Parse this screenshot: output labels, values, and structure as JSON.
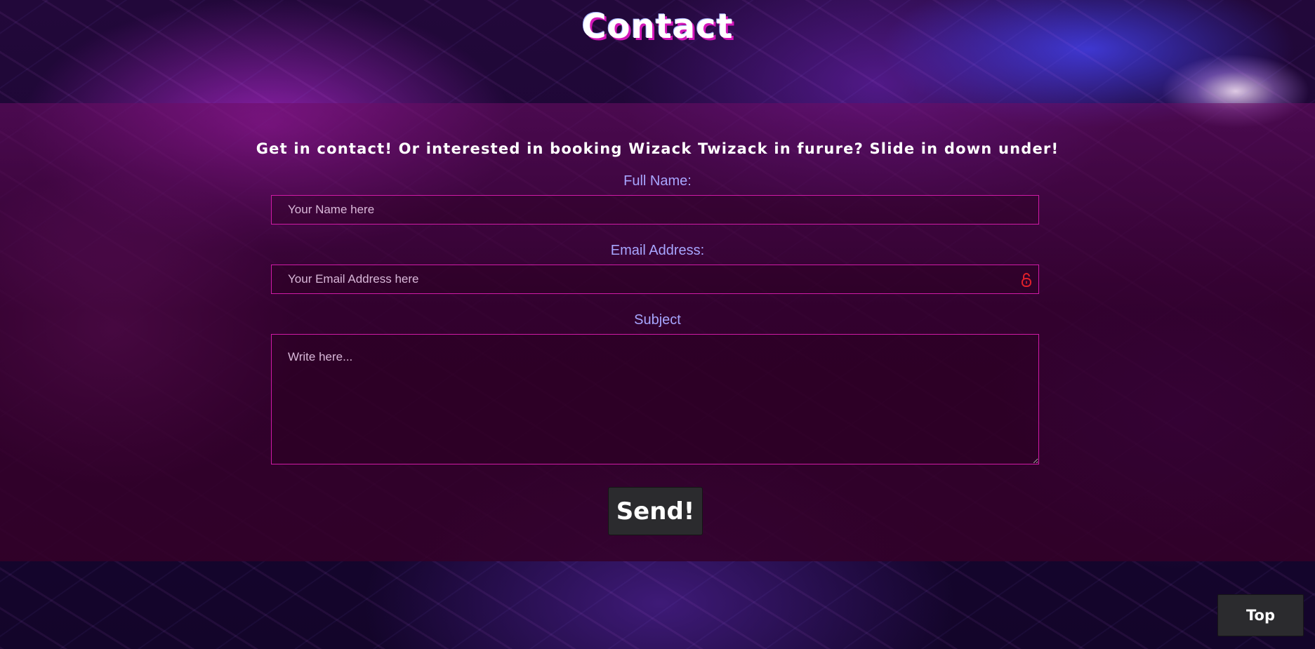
{
  "header": {
    "title": "Contact"
  },
  "contact": {
    "intro": "Get in contact! Or interested in booking Wizack Twizack in furure? Slide in down under!",
    "name_label": "Full Name:",
    "name_placeholder": "Your Name here",
    "email_label": "Email Address:",
    "email_placeholder": "Your Email Address here",
    "subject_label": "Subject",
    "subject_placeholder": "Write here...",
    "send_label": "Send!"
  },
  "footer": {
    "top_label": "Top"
  },
  "icons": {
    "email_lock": "lock-icon"
  },
  "colors": {
    "accent_border": "#d01aa6",
    "label_color": "#a8a6ff",
    "lock_icon": "#e0202a",
    "button_bg": "#2b2b2e"
  }
}
